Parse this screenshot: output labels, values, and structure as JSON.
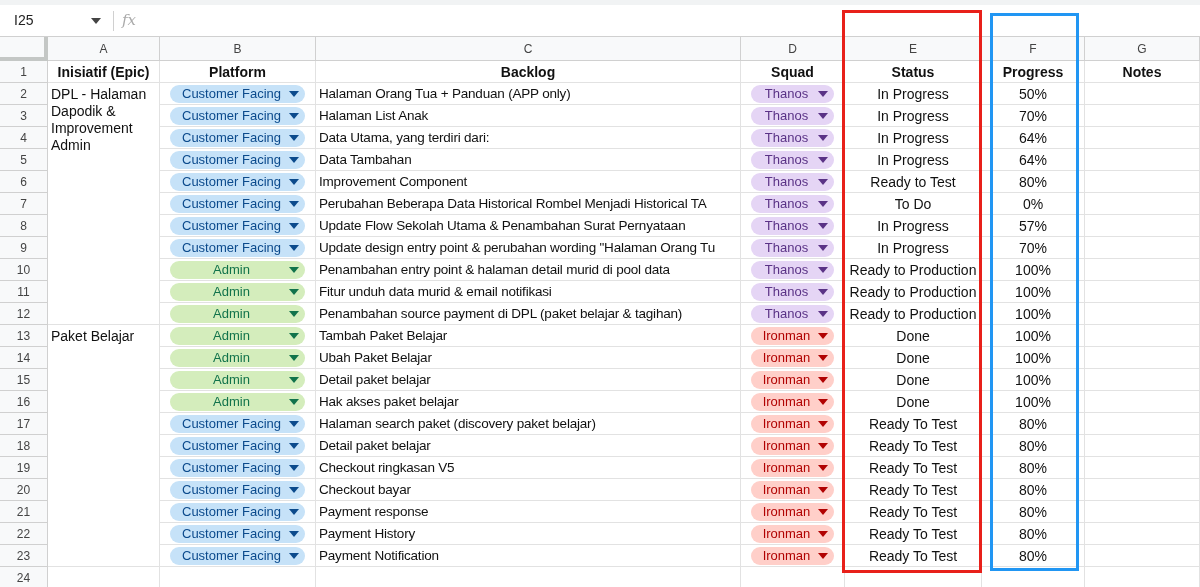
{
  "name_box": "I25",
  "formula_label": "fx",
  "columns": [
    {
      "letter": "A"
    },
    {
      "letter": "B"
    },
    {
      "letter": "C"
    },
    {
      "letter": "D"
    },
    {
      "letter": "E",
      "color": "#e8201a"
    },
    {
      "letter": "F",
      "color": "#2196f3"
    },
    {
      "letter": "G"
    }
  ],
  "header": {
    "number": "1",
    "cells": [
      "Inisiatif (Epic)",
      "Platform",
      "Backlog",
      "Squad",
      "Status",
      "Progress",
      "Notes"
    ]
  },
  "groups": [
    {
      "epic": "DPL - Halaman Dapodik & Improvement Admin",
      "rows": [
        {
          "number": "2",
          "platform": {
            "label": "Customer Facing",
            "color": "#c6e2f8"
          },
          "backlog": "Halaman Orang Tua + Panduan (APP only)",
          "squad": {
            "label": "Thanos",
            "color": "#e5d5f5"
          },
          "status": "In Progress",
          "progress": "50%"
        },
        {
          "number": "3",
          "platform": {
            "label": "Customer Facing",
            "color": "#c6e2f8"
          },
          "backlog": "Halaman List Anak",
          "squad": {
            "label": "Thanos",
            "color": "#e5d5f5"
          },
          "status": "In Progress",
          "progress": "70%"
        },
        {
          "number": "4",
          "platform": {
            "label": "Customer Facing",
            "color": "#c6e2f8"
          },
          "backlog": "Data Utama, yang terdiri dari:",
          "squad": {
            "label": "Thanos",
            "color": "#e5d5f5"
          },
          "status": "In Progress",
          "progress": "64%"
        },
        {
          "number": "5",
          "platform": {
            "label": "Customer Facing",
            "color": "#c6e2f8"
          },
          "backlog": "Data Tambahan",
          "squad": {
            "label": "Thanos",
            "color": "#e5d5f5"
          },
          "status": "In Progress",
          "progress": "64%"
        },
        {
          "number": "6",
          "platform": {
            "label": "Customer Facing",
            "color": "#c6e2f8"
          },
          "backlog": "Improvement Component",
          "squad": {
            "label": "Thanos",
            "color": "#e5d5f5"
          },
          "status": "Ready to Test",
          "progress": "80%"
        },
        {
          "number": "7",
          "platform": {
            "label": "Customer Facing",
            "color": "#c6e2f8"
          },
          "backlog": "Perubahan Beberapa Data Historical Rombel Menjadi Historical TA",
          "squad": {
            "label": "Thanos",
            "color": "#e5d5f5"
          },
          "status": "To Do",
          "progress": "0%"
        },
        {
          "number": "8",
          "platform": {
            "label": "Customer Facing",
            "color": "#c6e2f8"
          },
          "backlog": "Update Flow Sekolah Utama & Penambahan Surat Pernyataan",
          "squad": {
            "label": "Thanos",
            "color": "#e5d5f5"
          },
          "status": "In Progress",
          "progress": "57%"
        },
        {
          "number": "9",
          "platform": {
            "label": "Customer Facing",
            "color": "#c6e2f8"
          },
          "backlog": "Update design entry point & perubahan wording \"Halaman Orang Tu",
          "squad": {
            "label": "Thanos",
            "color": "#e5d5f5"
          },
          "status": "In Progress",
          "progress": "70%"
        },
        {
          "number": "10",
          "platform": {
            "label": "Admin",
            "color": "#d4edbc"
          },
          "backlog": "Penambahan entry point & halaman detail murid di pool data",
          "squad": {
            "label": "Thanos",
            "color": "#e5d5f5"
          },
          "status": "Ready to Production",
          "progress": "100%"
        },
        {
          "number": "11",
          "platform": {
            "label": "Admin",
            "color": "#d4edbc"
          },
          "backlog": "Fitur unduh data murid & email notifikasi",
          "squad": {
            "label": "Thanos",
            "color": "#e5d5f5"
          },
          "status": "Ready to Production",
          "progress": "100%"
        },
        {
          "number": "12",
          "platform": {
            "label": "Admin",
            "color": "#d4edbc"
          },
          "backlog": "Penambahan source payment di DPL (paket belajar & tagihan)",
          "squad": {
            "label": "Thanos",
            "color": "#e5d5f5"
          },
          "status": "Ready to Production",
          "progress": "100%"
        }
      ]
    },
    {
      "epic": "Paket Belajar",
      "rows": [
        {
          "number": "13",
          "platform": {
            "label": "Admin",
            "color": "#d4edbc"
          },
          "backlog": "Tambah Paket Belajar",
          "squad": {
            "label": "Ironman",
            "color": "#ffcfc9"
          },
          "status": "Done",
          "progress": "100%"
        },
        {
          "number": "14",
          "platform": {
            "label": "Admin",
            "color": "#d4edbc"
          },
          "backlog": "Ubah Paket Belajar",
          "squad": {
            "label": "Ironman",
            "color": "#ffcfc9"
          },
          "status": "Done",
          "progress": "100%"
        },
        {
          "number": "15",
          "platform": {
            "label": "Admin",
            "color": "#d4edbc"
          },
          "backlog": "Detail paket belajar",
          "squad": {
            "label": "Ironman",
            "color": "#ffcfc9"
          },
          "status": "Done",
          "progress": "100%"
        },
        {
          "number": "16",
          "platform": {
            "label": "Admin",
            "color": "#d4edbc"
          },
          "backlog": "Hak akses paket belajar",
          "squad": {
            "label": "Ironman",
            "color": "#ffcfc9"
          },
          "status": "Done",
          "progress": "100%"
        },
        {
          "number": "17",
          "platform": {
            "label": "Customer Facing",
            "color": "#c6e2f8"
          },
          "backlog": "Halaman search paket (discovery paket belajar)",
          "squad": {
            "label": "Ironman",
            "color": "#ffcfc9"
          },
          "status": "Ready To Test",
          "progress": "80%"
        },
        {
          "number": "18",
          "platform": {
            "label": "Customer Facing",
            "color": "#c6e2f8"
          },
          "backlog": "Detail paket belajar",
          "squad": {
            "label": "Ironman",
            "color": "#ffcfc9"
          },
          "status": "Ready To Test",
          "progress": "80%"
        },
        {
          "number": "19",
          "platform": {
            "label": "Customer Facing",
            "color": "#c6e2f8"
          },
          "backlog": "Checkout ringkasan V5",
          "squad": {
            "label": "Ironman",
            "color": "#ffcfc9"
          },
          "status": "Ready To Test",
          "progress": "80%"
        },
        {
          "number": "20",
          "platform": {
            "label": "Customer Facing",
            "color": "#c6e2f8"
          },
          "backlog": "Checkout bayar",
          "squad": {
            "label": "Ironman",
            "color": "#ffcfc9"
          },
          "status": "Ready To Test",
          "progress": "80%"
        },
        {
          "number": "21",
          "platform": {
            "label": "Customer Facing",
            "color": "#c6e2f8"
          },
          "backlog": "Payment response",
          "squad": {
            "label": "Ironman",
            "color": "#ffcfc9"
          },
          "status": "Ready To Test",
          "progress": "80%"
        },
        {
          "number": "22",
          "platform": {
            "label": "Customer Facing",
            "color": "#c6e2f8"
          },
          "backlog": "Payment History",
          "squad": {
            "label": "Ironman",
            "color": "#ffcfc9"
          },
          "status": "Ready To Test",
          "progress": "80%"
        },
        {
          "number": "23",
          "platform": {
            "label": "Customer Facing",
            "color": "#c6e2f8"
          },
          "backlog": "Payment Notification",
          "squad": {
            "label": "Ironman",
            "color": "#ffcfc9"
          },
          "status": "Ready To Test",
          "progress": "80%"
        }
      ]
    }
  ],
  "empty_rows": [
    "24"
  ]
}
